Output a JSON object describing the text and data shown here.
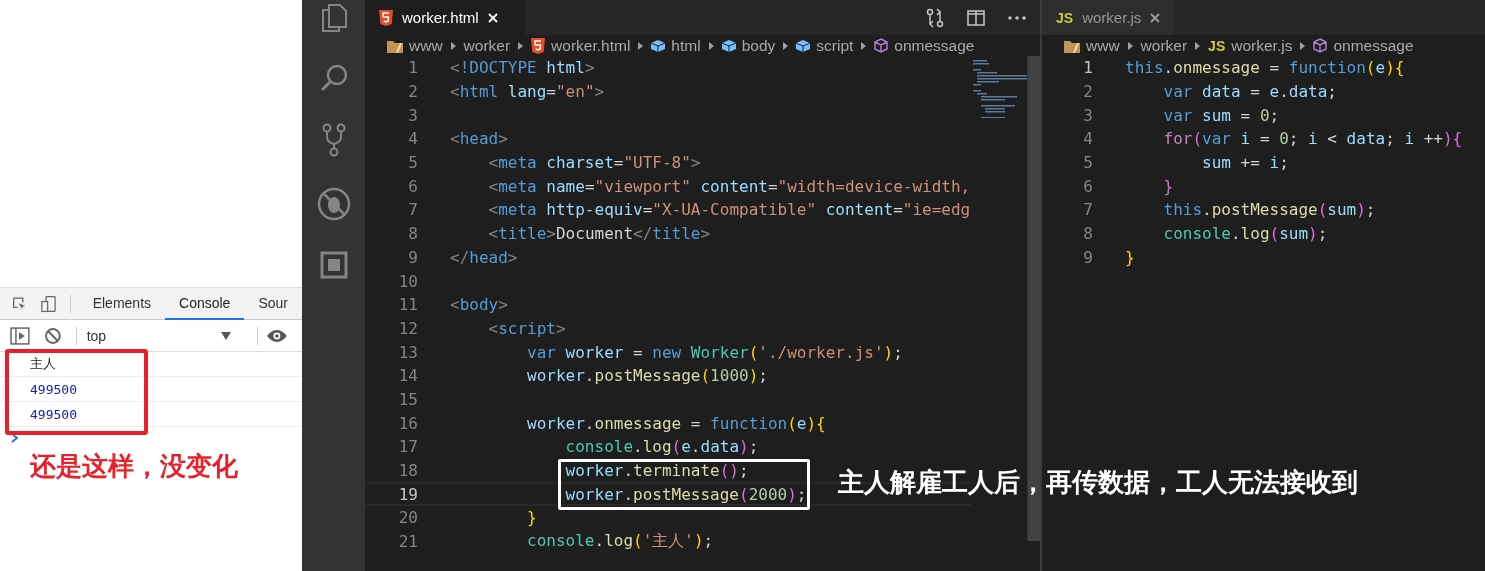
{
  "devtools": {
    "tabs": [
      {
        "label": "Elements",
        "selected": false
      },
      {
        "label": "Console",
        "selected": true
      },
      {
        "label": "Sour",
        "selected": false
      }
    ],
    "context": "top",
    "console_rows": [
      {
        "text": "主人",
        "kind": "text"
      },
      {
        "text": "499500",
        "kind": "number"
      },
      {
        "text": "499500",
        "kind": "number"
      }
    ]
  },
  "editors": [
    {
      "tab": {
        "title": "worker.html",
        "kind": "html",
        "active": true
      },
      "breadcrumb": [
        {
          "label": "www",
          "kind": "folder"
        },
        {
          "label": "worker",
          "kind": "plain"
        },
        {
          "label": "worker.html",
          "kind": "html"
        },
        {
          "label": "html",
          "kind": "element"
        },
        {
          "label": "body",
          "kind": "element"
        },
        {
          "label": "script",
          "kind": "element"
        },
        {
          "label": "onmessage",
          "kind": "method"
        }
      ],
      "lines": [
        {
          "number": "1",
          "current": false,
          "tokens": [
            {
              "text": "<",
              "kind": "punct"
            },
            {
              "text": "!DOCTYPE",
              "kind": "tag"
            },
            {
              "text": " html",
              "kind": "attr"
            },
            {
              "text": ">",
              "kind": "punct"
            }
          ]
        },
        {
          "number": "2",
          "current": false,
          "tokens": [
            {
              "text": "<",
              "kind": "punct"
            },
            {
              "text": "html",
              "kind": "tag"
            },
            {
              "text": " lang",
              "kind": "attr"
            },
            {
              "text": "=",
              "kind": "plain"
            },
            {
              "text": "\"en\"",
              "kind": "string"
            },
            {
              "text": ">",
              "kind": "punct"
            }
          ]
        },
        {
          "number": "3",
          "current": false
        },
        {
          "number": "4",
          "current": false,
          "tokens": [
            {
              "text": "<",
              "kind": "punct"
            },
            {
              "text": "head",
              "kind": "tag"
            },
            {
              "text": ">",
              "kind": "punct"
            }
          ]
        },
        {
          "number": "5",
          "current": false,
          "tokens": [
            {
              "text": "    <",
              "kind": "punct"
            },
            {
              "text": "meta",
              "kind": "tag"
            },
            {
              "text": " charset",
              "kind": "attr"
            },
            {
              "text": "=",
              "kind": "plain"
            },
            {
              "text": "\"UTF-8\"",
              "kind": "string"
            },
            {
              "text": ">",
              "kind": "punct"
            }
          ]
        },
        {
          "number": "6",
          "current": false,
          "tokens": [
            {
              "text": "    <",
              "kind": "punct"
            },
            {
              "text": "meta",
              "kind": "tag"
            },
            {
              "text": " name",
              "kind": "attr"
            },
            {
              "text": "=",
              "kind": "plain"
            },
            {
              "text": "\"viewport\"",
              "kind": "string"
            },
            {
              "text": " content",
              "kind": "attr"
            },
            {
              "text": "=",
              "kind": "plain"
            },
            {
              "text": "\"width=device-width,",
              "kind": "string"
            }
          ]
        },
        {
          "number": "7",
          "current": false,
          "tokens": [
            {
              "text": "    <",
              "kind": "punct"
            },
            {
              "text": "meta",
              "kind": "tag"
            },
            {
              "text": " http-equiv",
              "kind": "attr"
            },
            {
              "text": "=",
              "kind": "plain"
            },
            {
              "text": "\"X-UA-Compatible\"",
              "kind": "string"
            },
            {
              "text": " content",
              "kind": "attr"
            },
            {
              "text": "=",
              "kind": "plain"
            },
            {
              "text": "\"ie=edg",
              "kind": "string"
            }
          ]
        },
        {
          "number": "8",
          "current": false,
          "tokens": [
            {
              "text": "    <",
              "kind": "punct"
            },
            {
              "text": "title",
              "kind": "tag"
            },
            {
              "text": ">",
              "kind": "punct"
            },
            {
              "text": "Document",
              "kind": "plain"
            },
            {
              "text": "</",
              "kind": "punct"
            },
            {
              "text": "title",
              "kind": "tag"
            },
            {
              "text": ">",
              "kind": "punct"
            }
          ]
        },
        {
          "number": "9",
          "current": false,
          "tokens": [
            {
              "text": "</",
              "kind": "punct"
            },
            {
              "text": "head",
              "kind": "tag"
            },
            {
              "text": ">",
              "kind": "punct"
            }
          ]
        },
        {
          "number": "10",
          "current": false
        },
        {
          "number": "11",
          "current": false,
          "tokens": [
            {
              "text": "<",
              "kind": "punct"
            },
            {
              "text": "body",
              "kind": "tag"
            },
            {
              "text": ">",
              "kind": "punct"
            }
          ]
        },
        {
          "number": "12",
          "current": false,
          "tokens": [
            {
              "text": "    <",
              "kind": "punct"
            },
            {
              "text": "script",
              "kind": "tag"
            },
            {
              "text": ">",
              "kind": "punct"
            }
          ]
        },
        {
          "number": "13",
          "current": false,
          "tokens": [
            {
              "text": "        var",
              "kind": "keyword"
            },
            {
              "text": " worker",
              "kind": "variable"
            },
            {
              "text": " = ",
              "kind": "plain"
            },
            {
              "text": "new",
              "kind": "keyword"
            },
            {
              "text": " Worker",
              "kind": "class"
            },
            {
              "text": "(",
              "kind": "bracket1"
            },
            {
              "text": "'./worker.js'",
              "kind": "string"
            },
            {
              "text": ")",
              "kind": "bracket1"
            },
            {
              "text": ";",
              "kind": "plain"
            }
          ]
        },
        {
          "number": "14",
          "current": false,
          "tokens": [
            {
              "text": "        worker",
              "kind": "variable"
            },
            {
              "text": ".",
              "kind": "plain"
            },
            {
              "text": "postMessage",
              "kind": "function"
            },
            {
              "text": "(",
              "kind": "bracket1"
            },
            {
              "text": "1000",
              "kind": "number"
            },
            {
              "text": ")",
              "kind": "bracket1"
            },
            {
              "text": ";",
              "kind": "plain"
            }
          ]
        },
        {
          "number": "15",
          "current": false
        },
        {
          "number": "16",
          "current": false,
          "tokens": [
            {
              "text": "        worker",
              "kind": "variable"
            },
            {
              "text": ".",
              "kind": "plain"
            },
            {
              "text": "onmessage",
              "kind": "function"
            },
            {
              "text": " = ",
              "kind": "plain"
            },
            {
              "text": "function",
              "kind": "keyword"
            },
            {
              "text": "(",
              "kind": "bracket1"
            },
            {
              "text": "e",
              "kind": "variable"
            },
            {
              "text": ")",
              "kind": "bracket1"
            },
            {
              "text": "{",
              "kind": "bracket1"
            }
          ]
        },
        {
          "number": "17",
          "current": false,
          "tokens": [
            {
              "text": "            console",
              "kind": "class"
            },
            {
              "text": ".",
              "kind": "plain"
            },
            {
              "text": "log",
              "kind": "function"
            },
            {
              "text": "(",
              "kind": "bracket2"
            },
            {
              "text": "e",
              "kind": "variable"
            },
            {
              "text": ".",
              "kind": "plain"
            },
            {
              "text": "data",
              "kind": "variable"
            },
            {
              "text": ")",
              "kind": "bracket2"
            },
            {
              "text": ";",
              "kind": "plain"
            }
          ]
        },
        {
          "number": "18",
          "current": false,
          "tokens": [
            {
              "text": "            worker",
              "kind": "variable"
            },
            {
              "text": ".",
              "kind": "plain"
            },
            {
              "text": "terminate",
              "kind": "function"
            },
            {
              "text": "()",
              "kind": "bracket2"
            },
            {
              "text": ";",
              "kind": "plain"
            }
          ]
        },
        {
          "number": "19",
          "current": true,
          "tokens": [
            {
              "text": "            worker",
              "kind": "variable"
            },
            {
              "text": ".",
              "kind": "plain"
            },
            {
              "text": "postMessage",
              "kind": "function"
            },
            {
              "text": "(",
              "kind": "bracket2"
            },
            {
              "text": "2000",
              "kind": "number"
            },
            {
              "text": ")",
              "kind": "bracket2"
            },
            {
              "text": ";",
              "kind": "plain"
            }
          ]
        },
        {
          "number": "20",
          "current": false,
          "tokens": [
            {
              "text": "        }",
              "kind": "bracket1"
            }
          ]
        },
        {
          "number": "21",
          "current": false,
          "tokens": [
            {
              "text": "        console",
              "kind": "class"
            },
            {
              "text": ".",
              "kind": "plain"
            },
            {
              "text": "log",
              "kind": "function"
            },
            {
              "text": "(",
              "kind": "bracket1"
            },
            {
              "text": "'主人'",
              "kind": "string"
            },
            {
              "text": ")",
              "kind": "bracket1"
            },
            {
              "text": ";",
              "kind": "plain"
            }
          ]
        }
      ]
    },
    {
      "tab": {
        "title": "worker.js",
        "kind": "js",
        "icon_text": "JS",
        "active": false
      },
      "breadcrumb": [
        {
          "label": "www",
          "kind": "folder"
        },
        {
          "label": "worker",
          "kind": "plain"
        },
        {
          "label": "worker.js",
          "kind": "js",
          "icon_text": "JS"
        },
        {
          "label": "onmessage",
          "kind": "method"
        }
      ],
      "lines": [
        {
          "number": "1",
          "current": true,
          "tokens": [
            {
              "text": "this",
              "kind": "keyword"
            },
            {
              "text": ".",
              "kind": "plain"
            },
            {
              "text": "onmessage",
              "kind": "function"
            },
            {
              "text": " = ",
              "kind": "plain"
            },
            {
              "text": "function",
              "kind": "keyword"
            },
            {
              "text": "(",
              "kind": "bracket1"
            },
            {
              "text": "e",
              "kind": "variable"
            },
            {
              "text": ")",
              "kind": "bracket1"
            },
            {
              "text": "{",
              "kind": "bracket1"
            }
          ]
        },
        {
          "number": "2",
          "current": false,
          "tokens": [
            {
              "text": "    var",
              "kind": "keyword"
            },
            {
              "text": " data",
              "kind": "variable"
            },
            {
              "text": " = ",
              "kind": "plain"
            },
            {
              "text": "e",
              "kind": "variable"
            },
            {
              "text": ".",
              "kind": "plain"
            },
            {
              "text": "data",
              "kind": "variable"
            },
            {
              "text": ";",
              "kind": "plain"
            }
          ]
        },
        {
          "number": "3",
          "current": false,
          "tokens": [
            {
              "text": "    var",
              "kind": "keyword"
            },
            {
              "text": " sum",
              "kind": "variable"
            },
            {
              "text": " = ",
              "kind": "plain"
            },
            {
              "text": "0",
              "kind": "number"
            },
            {
              "text": ";",
              "kind": "plain"
            }
          ]
        },
        {
          "number": "4",
          "current": false,
          "tokens": [
            {
              "text": "    for",
              "kind": "control"
            },
            {
              "text": "(",
              "kind": "bracket2"
            },
            {
              "text": "var",
              "kind": "keyword"
            },
            {
              "text": " i",
              "kind": "variable"
            },
            {
              "text": " = ",
              "kind": "plain"
            },
            {
              "text": "0",
              "kind": "number"
            },
            {
              "text": "; ",
              "kind": "plain"
            },
            {
              "text": "i",
              "kind": "variable"
            },
            {
              "text": " < ",
              "kind": "plain"
            },
            {
              "text": "data",
              "kind": "variable"
            },
            {
              "text": "; ",
              "kind": "plain"
            },
            {
              "text": "i",
              "kind": "variable"
            },
            {
              "text": " ++",
              "kind": "plain"
            },
            {
              "text": ")",
              "kind": "bracket2"
            },
            {
              "text": "{",
              "kind": "bracket2"
            }
          ]
        },
        {
          "number": "5",
          "current": false,
          "tokens": [
            {
              "text": "        sum",
              "kind": "variable"
            },
            {
              "text": " += ",
              "kind": "plain"
            },
            {
              "text": "i",
              "kind": "variable"
            },
            {
              "text": ";",
              "kind": "plain"
            }
          ]
        },
        {
          "number": "6",
          "current": false,
          "tokens": [
            {
              "text": "    }",
              "kind": "bracket2"
            }
          ]
        },
        {
          "number": "7",
          "current": false,
          "tokens": [
            {
              "text": "    this",
              "kind": "keyword"
            },
            {
              "text": ".",
              "kind": "plain"
            },
            {
              "text": "postMessage",
              "kind": "function"
            },
            {
              "text": "(",
              "kind": "bracket2"
            },
            {
              "text": "sum",
              "kind": "variable"
            },
            {
              "text": ")",
              "kind": "bracket2"
            },
            {
              "text": ";",
              "kind": "plain"
            }
          ]
        },
        {
          "number": "8",
          "current": false,
          "tokens": [
            {
              "text": "    console",
              "kind": "class"
            },
            {
              "text": ".",
              "kind": "plain"
            },
            {
              "text": "log",
              "kind": "function"
            },
            {
              "text": "(",
              "kind": "bracket2"
            },
            {
              "text": "sum",
              "kind": "variable"
            },
            {
              "text": ")",
              "kind": "bracket2"
            },
            {
              "text": ";",
              "kind": "plain"
            }
          ]
        },
        {
          "number": "9",
          "current": false,
          "tokens": [
            {
              "text": "}",
              "kind": "bracket1"
            }
          ]
        }
      ]
    }
  ],
  "annotations": [
    {
      "text": "还是这样，没变化",
      "kind": "red"
    },
    {
      "text": "主人解雇工人后，再传数据，工人无法接收到",
      "kind": "white"
    }
  ]
}
